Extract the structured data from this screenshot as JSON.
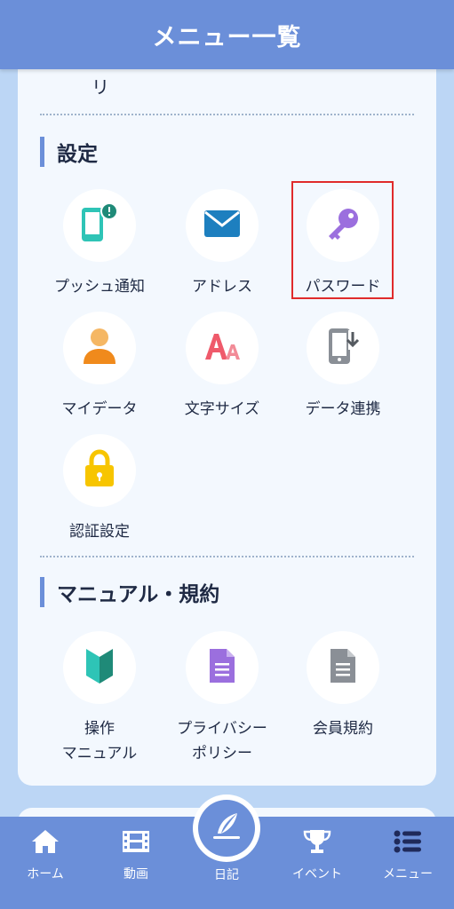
{
  "header": {
    "title": "メニュー一覧"
  },
  "cut_off_text": "リ",
  "sections": [
    {
      "title": "設定",
      "items": [
        {
          "label": "プッシュ通知",
          "icon": "push-notification-icon"
        },
        {
          "label": "アドレス",
          "icon": "mail-icon"
        },
        {
          "label": "パスワード",
          "icon": "key-icon"
        },
        {
          "label": "マイデータ",
          "icon": "person-icon"
        },
        {
          "label": "文字サイズ",
          "icon": "font-size-icon"
        },
        {
          "label": "データ連携",
          "icon": "phone-download-icon"
        },
        {
          "label": "認証設定",
          "icon": "lock-icon"
        }
      ]
    },
    {
      "title": "マニュアル・規約",
      "items": [
        {
          "label": "操作\nマニュアル",
          "icon": "beginner-mark-icon"
        },
        {
          "label": "プライバシー\nポリシー",
          "icon": "purple-document-icon"
        },
        {
          "label": "会員規約",
          "icon": "gray-document-icon"
        }
      ]
    }
  ],
  "tabbar": {
    "tabs": [
      {
        "label": "ホーム",
        "icon": "home-icon"
      },
      {
        "label": "動画",
        "icon": "film-icon"
      },
      {
        "label": "日記",
        "icon": "diary-quill-icon"
      },
      {
        "label": "イベント",
        "icon": "trophy-icon"
      },
      {
        "label": "メニュー",
        "icon": "list-icon"
      }
    ]
  },
  "colors": {
    "header": "#6b8fd9",
    "background": "#bcd6f5",
    "card": "#f3f8fe",
    "highlight": "#e02b2b"
  }
}
